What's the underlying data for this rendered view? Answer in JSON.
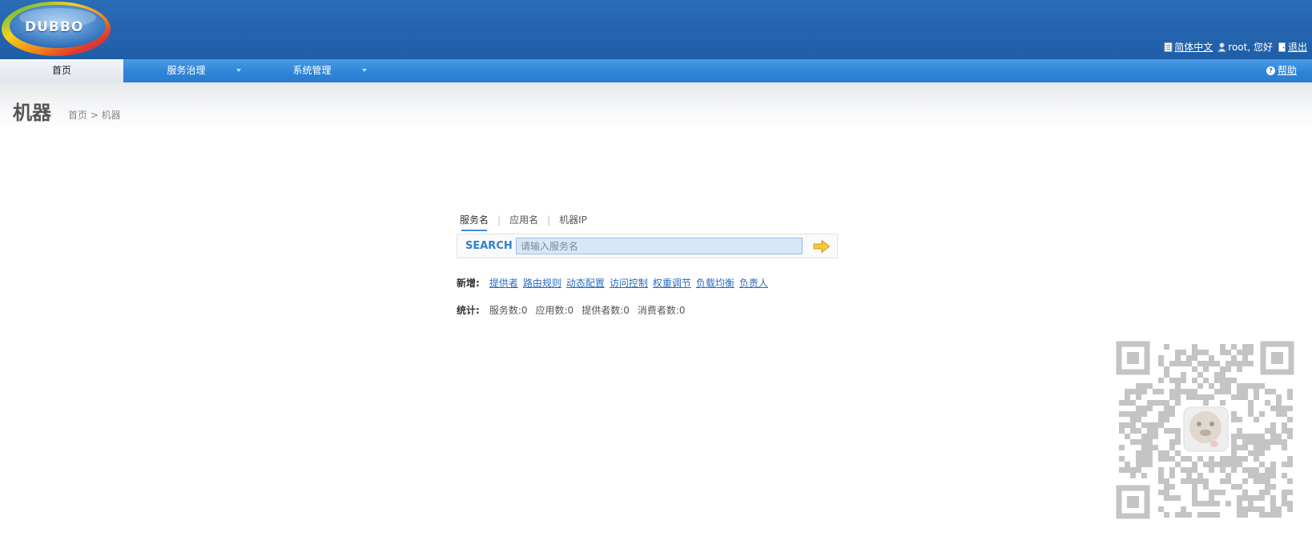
{
  "header": {
    "logo_text": "DUBBO",
    "links": {
      "language": "简体中文",
      "user": "root, 您好",
      "logout": "退出"
    }
  },
  "nav": {
    "items": [
      {
        "label": "首页",
        "active": true
      },
      {
        "label": "服务治理",
        "dropdown": true
      },
      {
        "label": "系统管理",
        "dropdown": true
      }
    ],
    "help": "帮助"
  },
  "page": {
    "title": "机器",
    "breadcrumb": "首页 > 机器"
  },
  "search": {
    "tabs": [
      "服务名",
      "应用名",
      "机器IP"
    ],
    "active_tab": "服务名",
    "label": "SEARCH",
    "placeholder": "请输入服务名",
    "value": ""
  },
  "create": {
    "label": "新增:",
    "links": [
      "提供者",
      "路由规则",
      "动态配置",
      "访问控制",
      "权重调节",
      "负载均衡",
      "负责人"
    ]
  },
  "stats": {
    "label": "统计:",
    "items": [
      "服务数:0",
      "应用数:0",
      "提供者数:0",
      "消费者数:0"
    ]
  },
  "colors": {
    "header_bg": "#2163b0",
    "nav_bg": "#2f85d8",
    "link": "#2a6bbf",
    "search_accent": "#2f7fd0"
  }
}
